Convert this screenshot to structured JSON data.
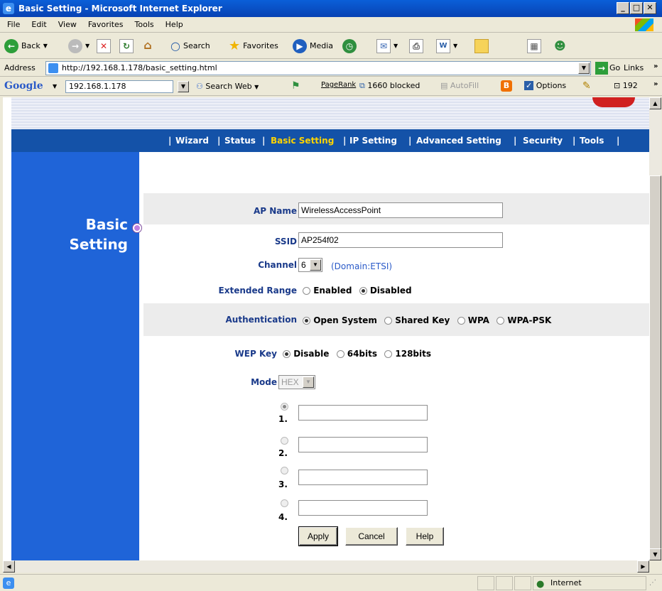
{
  "window": {
    "title": "Basic Setting - Microsoft Internet Explorer"
  },
  "menu": [
    "File",
    "Edit",
    "View",
    "Favorites",
    "Tools",
    "Help"
  ],
  "toolbar": {
    "back": "Back",
    "search": "Search",
    "favorites": "Favorites",
    "media": "Media"
  },
  "address": {
    "label": "Address",
    "url": "http://192.168.1.178/basic_setting.html",
    "go": "Go",
    "links": "Links"
  },
  "google": {
    "logo": "Google",
    "query": "192.168.1.178",
    "search_web": "Search Web",
    "pagerank": "PageRank",
    "blocked": "1660 blocked",
    "autofill": "AutoFill",
    "options": "Options",
    "count": "192"
  },
  "nav": {
    "items": [
      "Wizard",
      "Status",
      "Basic Setting",
      "IP Setting",
      "Advanced Setting",
      "Security",
      "Tools"
    ],
    "active": "Basic Setting"
  },
  "page": {
    "title_line1": "Basic",
    "title_line2": "Setting"
  },
  "form": {
    "ap_name": {
      "label": "AP Name",
      "value": "WirelessAccessPoint"
    },
    "ssid": {
      "label": "SSID",
      "value": "AP254f02"
    },
    "channel": {
      "label": "Channel",
      "value": "6",
      "domain": "(Domain:ETSI)"
    },
    "extended_range": {
      "label": "Extended Range",
      "options": [
        "Enabled",
        "Disabled"
      ],
      "selected": "Disabled"
    },
    "authentication": {
      "label": "Authentication",
      "options": [
        "Open System",
        "Shared Key",
        "WPA",
        "WPA-PSK"
      ],
      "selected": "Open System"
    },
    "wep_key": {
      "label": "WEP Key",
      "options": [
        "Disable",
        "64bits",
        "128bits"
      ],
      "selected": "Disable"
    },
    "mode": {
      "label": "Mode",
      "value": "HEX"
    },
    "keys": [
      {
        "num": "1.",
        "value": ""
      },
      {
        "num": "2.",
        "value": ""
      },
      {
        "num": "3.",
        "value": ""
      },
      {
        "num": "4.",
        "value": ""
      }
    ],
    "buttons": {
      "apply": "Apply",
      "cancel": "Cancel",
      "help": "Help"
    }
  },
  "status": {
    "zone": "Internet"
  },
  "colors": {
    "nav_bg": "#1452a8",
    "nav_active": "#ffd400",
    "side_bg": "#1f64d8",
    "label": "#1a3a8a",
    "domain": "#2a5ac8"
  }
}
